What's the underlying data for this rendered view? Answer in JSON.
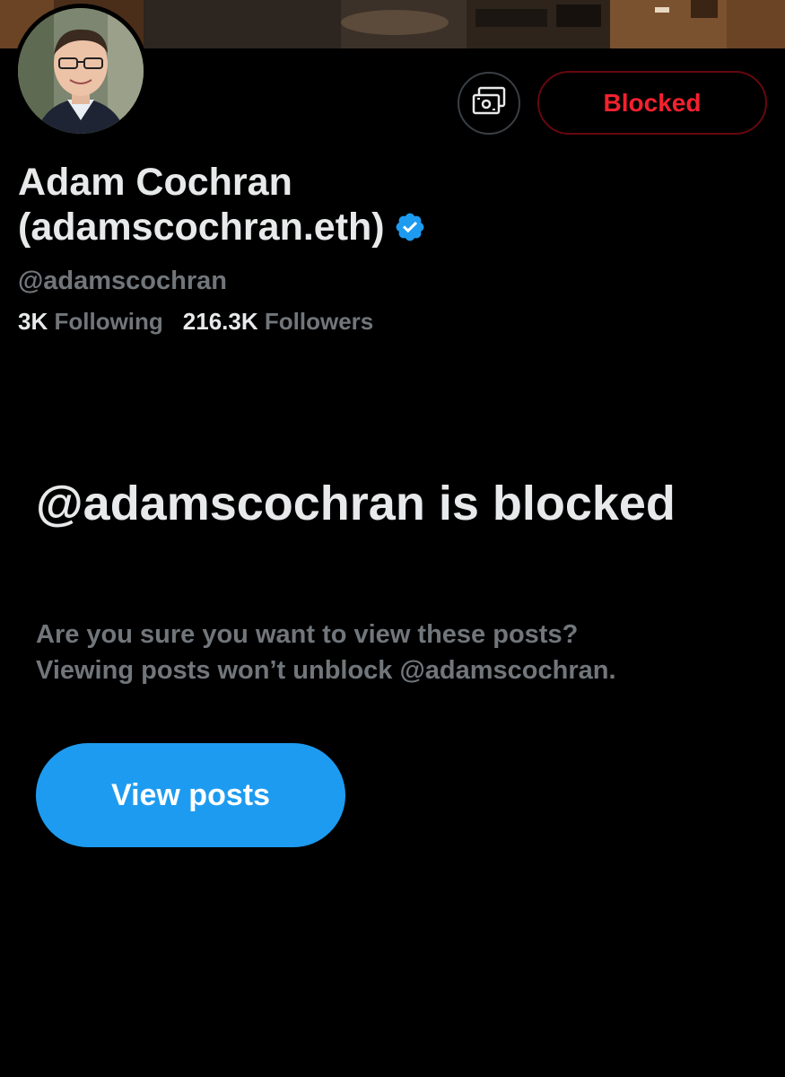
{
  "profile": {
    "display_name": "Adam Cochran (adamscochran.eth)",
    "handle": "@adamscochran",
    "following_count": "3K",
    "following_label": "Following",
    "followers_count": "216.3K",
    "followers_label": "Followers",
    "verified": true
  },
  "actions": {
    "tip_icon": "money-icon",
    "blocked_label": "Blocked"
  },
  "blocked_notice": {
    "title": "@adamscochran is blocked",
    "line1": "Are you sure you want to view these posts?",
    "line2": "Viewing posts won’t unblock @adamscochran.",
    "view_button_label": "View posts"
  },
  "colors": {
    "background": "#000000",
    "primary_text": "#e7e9ea",
    "secondary_text": "#71767b",
    "blocked_red": "#f4212e",
    "accent_blue": "#1d9bf0"
  }
}
